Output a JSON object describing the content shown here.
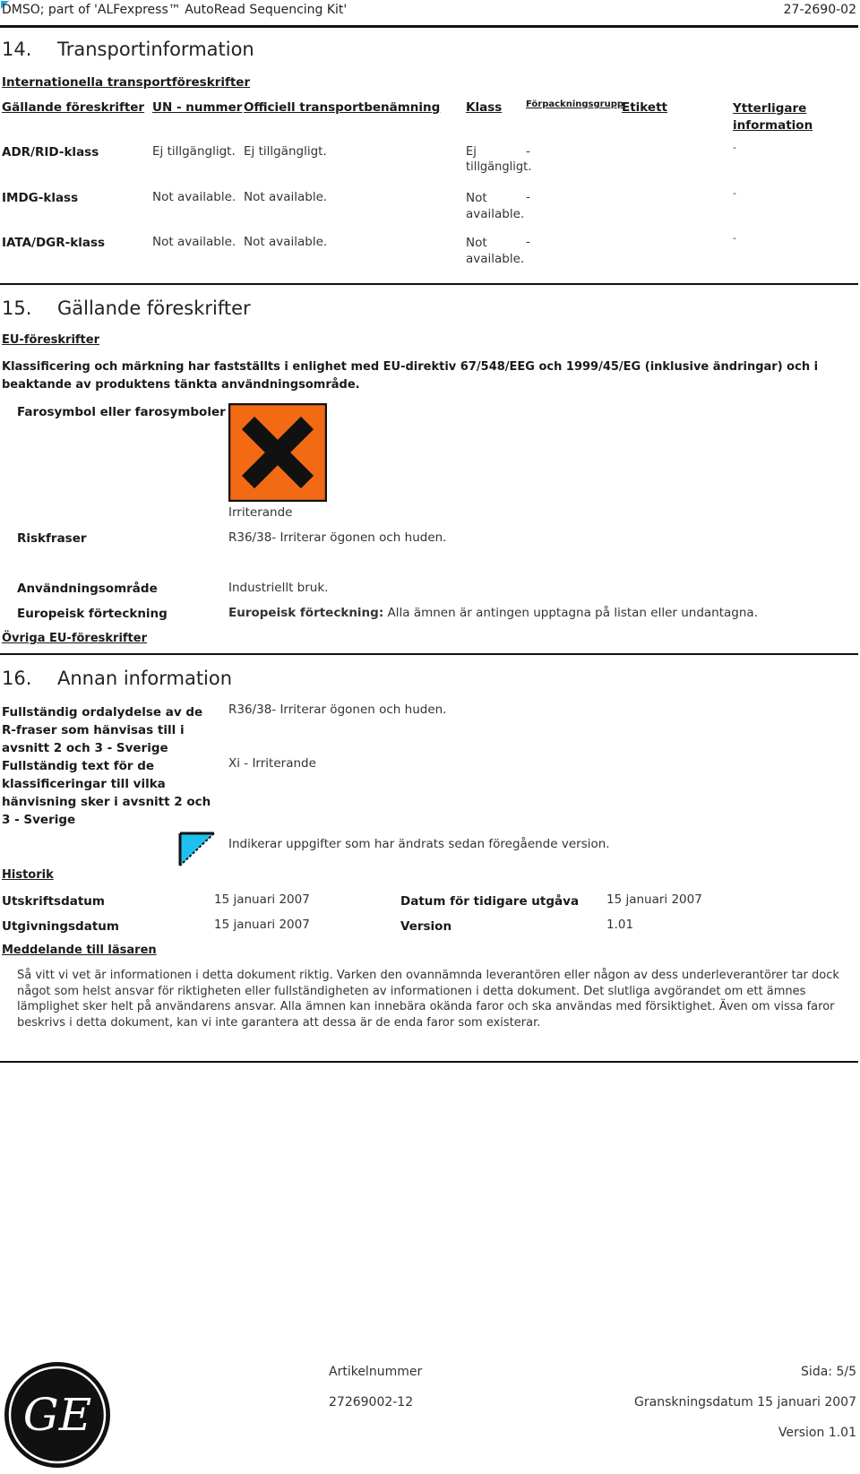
{
  "header": {
    "title": "DMSO; part of 'ALFexpress™ AutoRead Sequencing Kit'",
    "doc_code": "27-2690-02"
  },
  "section14": {
    "number": "14.",
    "title": "Transportinformation",
    "subheading": "Internationella transportföreskrifter",
    "columns": [
      "Gällande föreskrifter",
      "UN - nummer",
      "Officiell transportbenämning",
      "Klass",
      "Förpackningsgrupp",
      "Etikett",
      "Ytterligare information"
    ],
    "rows": [
      {
        "regulation": "ADR/RID-klass",
        "un": "Ej tillgängligt.",
        "name": "Ej tillgängligt.",
        "klass": "Ej tillgängligt.",
        "pg": "-",
        "label": "",
        "extra": "-"
      },
      {
        "regulation": "IMDG-klass",
        "un": "Not available.",
        "name": "Not available.",
        "klass": "Not available.",
        "pg": "-",
        "label": "",
        "extra": "-"
      },
      {
        "regulation": "IATA/DGR-klass",
        "un": "Not available.",
        "name": "Not available.",
        "klass": "Not available.",
        "pg": "-",
        "label": "",
        "extra": "-"
      }
    ]
  },
  "section15": {
    "number": "15.",
    "title": "Gällande föreskrifter",
    "subheading": "EU-föreskrifter",
    "classification_text": "Klassificering och märkning har fastställts i enlighet med EU-direktiv 67/548/EEG och 1999/45/EG (inklusive ändringar) och i  beaktande av produktens tänkta användningsområde.",
    "hazard_symbol_label": "Farosymbol eller farosymboler",
    "hazard_symbol_icon": "irritant-x-icon",
    "hazard_symbol_caption": "Irriterande",
    "hazard_colors": {
      "background": "#f26a13",
      "cross": "#111111"
    },
    "risk_label": "Riskfraser",
    "risk_value": "R36/38- Irriterar ögonen och huden.",
    "use_label": "Användningsområde",
    "use_value": "Industriellt bruk.",
    "eu_inventory_label": "Europeisk förteckning",
    "eu_inventory_value_label": "Europeisk förteckning:",
    "eu_inventory_value": "Alla ämnen är antingen upptagna på listan eller undantagna.",
    "other_eu_heading": "Övriga EU-föreskrifter"
  },
  "section16": {
    "number": "16.",
    "title": "Annan information",
    "r_phrases_label": "Fullständig ordalydelse av de R-fraser som hänvisas till i avsnitt 2 och 3  -  Sverige",
    "r_phrases_value": "R36/38- Irriterar ögonen och huden.",
    "classifications_label": "Fullständig text för de klassificeringar till vilka hänvisning sker i avsnitt 2 och 3  - Sverige",
    "classifications_value": "Xi - Irriterande",
    "change_marker_icon": "change-marker-icon",
    "change_marker_color": "#1fc0f0",
    "change_marker_text": "Indikerar uppgifter som har ändrats sedan föregående version.",
    "history_heading": "Historik",
    "print_date_label": "Utskriftsdatum",
    "print_date": "15 januari 2007",
    "issue_date_label": "Utgivningsdatum",
    "issue_date": "15 januari 2007",
    "prev_date_label": "Datum för tidigare utgåva",
    "prev_date": "15 januari 2007",
    "version_label": "Version",
    "version": "1.01",
    "notice_heading": "Meddelande till läsaren",
    "notice_text": "Så vitt vi vet är informationen i detta dokument riktig. Varken den ovannämnda leverantören eller någon av dess underleverantörer tar dock något som helst ansvar för riktigheten eller fullständigheten av informationen i detta dokument. Det slutliga avgörandet om ett ämnes lämplighet sker helt på användarens ansvar. Alla ämnen kan innebära okända faror och ska användas med försiktighet. Även om vissa faror beskrivs i detta dokument, kan vi inte garantera att dessa är de enda faror som existerar."
  },
  "footer": {
    "logo_icon": "ge-logo-icon",
    "article_label": "Artikelnummer",
    "article_number": "27269002-12",
    "page": "Sida: 5/5",
    "review_date": "Granskningsdatum 15 januari 2007",
    "version": "Version 1.01"
  }
}
